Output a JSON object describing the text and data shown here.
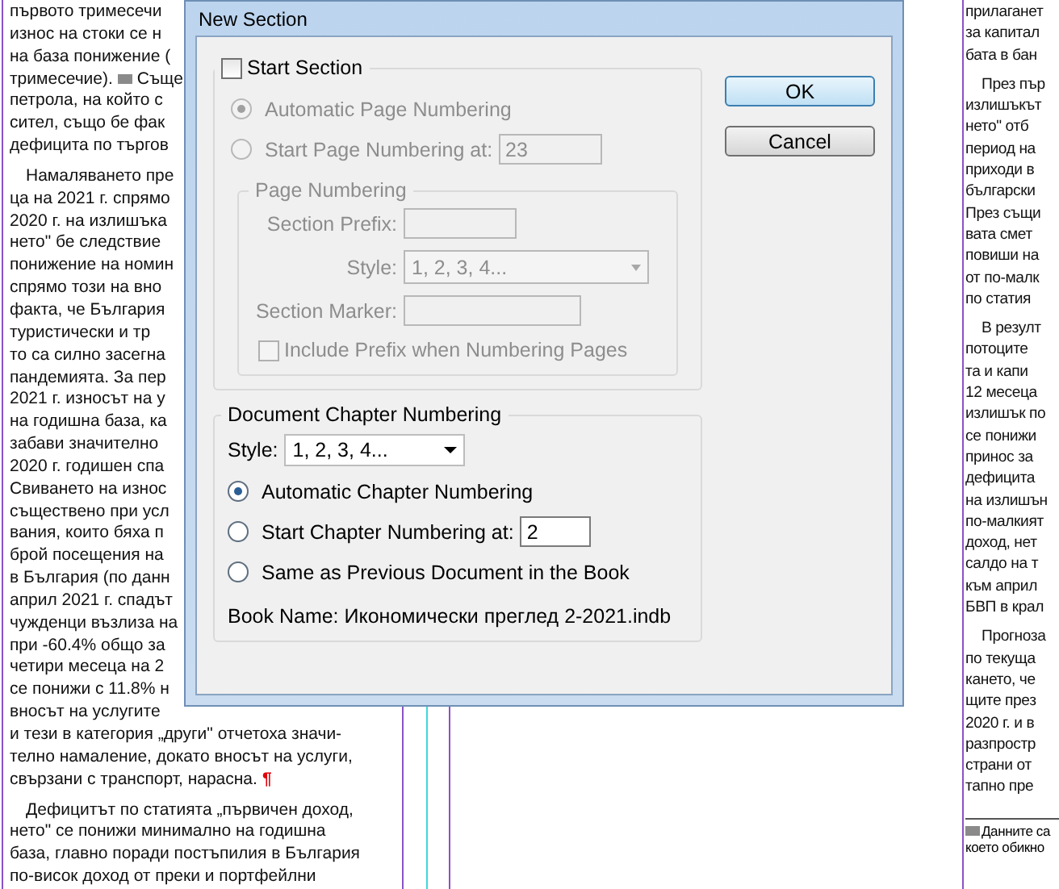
{
  "document": {
    "left_column": [
      {
        "lines": [
          "първото тримесечи",
          "износ на стоки се н",
          "на база понижение (",
          {
            "before": "тримесечие).",
            "footnote_ref": true,
            "after": "Съще"
          },
          "петрола, на който с",
          "сител, също бе фак",
          "дефицита по търгов"
        ]
      },
      {
        "lines": [
          "Намаляването пре",
          "ца на 2021 г. спрямо",
          "2020 г. на излишъка",
          "нето\" бе следствие",
          "понижение на номин",
          "спрямо този на вно",
          "факта, че България",
          "туристически и тр",
          "то са силно засегна",
          "пандемията. За пер",
          "2021 г. износът на у",
          "на годишна база, ка",
          "забави значително",
          "2020 г. годишен спа",
          "Свиването на износ",
          "съществено при усл",
          "вания, които бяха п",
          "брой посещения на",
          "в България (по данн",
          "април 2021 г. спадът",
          "чужденци възлиза на",
          "при -60.4% общо за",
          "четири месеца на 2",
          "се понижи с 11.8% н",
          "вносът на услугите",
          "и тези в категория „други\" отчетоха значи-",
          "телно намаление, докато вносът на услуги,",
          {
            "before": "свързани с транспорт, нарасна.",
            "end_mark": "¶"
          }
        ]
      },
      {
        "lines": [
          "Дефицитът по статията „първичен доход,",
          "нето\" се понижи минимално на годишна",
          "база, главно поради постъпилия в България",
          "по-висок доход от преки и портфейлни"
        ]
      }
    ],
    "right_column": [
      {
        "lines": [
          "прилаганет",
          "за капитал",
          "бата в бан"
        ]
      },
      {
        "lines": [
          "През пър",
          "излишъкът",
          "нето\" отб",
          "период на",
          "приходи в",
          "български",
          "През същи",
          "вата смет",
          "повиши на",
          "от по-малк",
          "по статия"
        ]
      },
      {
        "lines": [
          "В резулт",
          "потоците",
          "та и капи",
          "12 месеца",
          "излишък по",
          "се понижи",
          "принос за",
          "дефицита",
          "на излишън",
          "по-малкият",
          "доход, нет",
          "салдо на т",
          "към април",
          "БВП в крал"
        ]
      },
      {
        "lines": [
          "Прогноза",
          "по текуща",
          "кането, че",
          "щите през",
          "2020 г. и в",
          "разпростр",
          "страни от",
          "тапно пре"
        ]
      }
    ],
    "footnote": {
      "mark": true,
      "lines": [
        "Данните са",
        "което обикно"
      ]
    }
  },
  "dialog": {
    "title": "New Section",
    "start_section": {
      "label": "Start Section",
      "checked": false
    },
    "page_numbering_options": [
      {
        "label": "Automatic Page Numbering",
        "selected": true
      },
      {
        "label": "Start Page Numbering at:",
        "selected": false,
        "value": "23"
      }
    ],
    "page_numbering": {
      "title": "Page Numbering",
      "prefix_label": "Section Prefix:",
      "style_label": "Style:",
      "style_value": "1, 2, 3, 4...",
      "marker_label": "Section Marker:",
      "include_prefix": {
        "label": "Include Prefix when Numbering Pages",
        "checked": false
      }
    },
    "chapter": {
      "title": "Document Chapter Numbering",
      "style_label": "Style:",
      "style_value": "1, 2, 3, 4...",
      "options": [
        {
          "label": "Automatic Chapter Numbering",
          "selected": true
        },
        {
          "label": "Start Chapter Numbering at:",
          "selected": false,
          "value": "2"
        },
        {
          "label": "Same as Previous Document in the Book",
          "selected": false
        }
      ],
      "book_name": "Book Name: Икономически преглед 2-2021.indb"
    },
    "buttons": [
      {
        "label": "OK",
        "default": true
      },
      {
        "label": "Cancel",
        "default": false
      }
    ]
  }
}
